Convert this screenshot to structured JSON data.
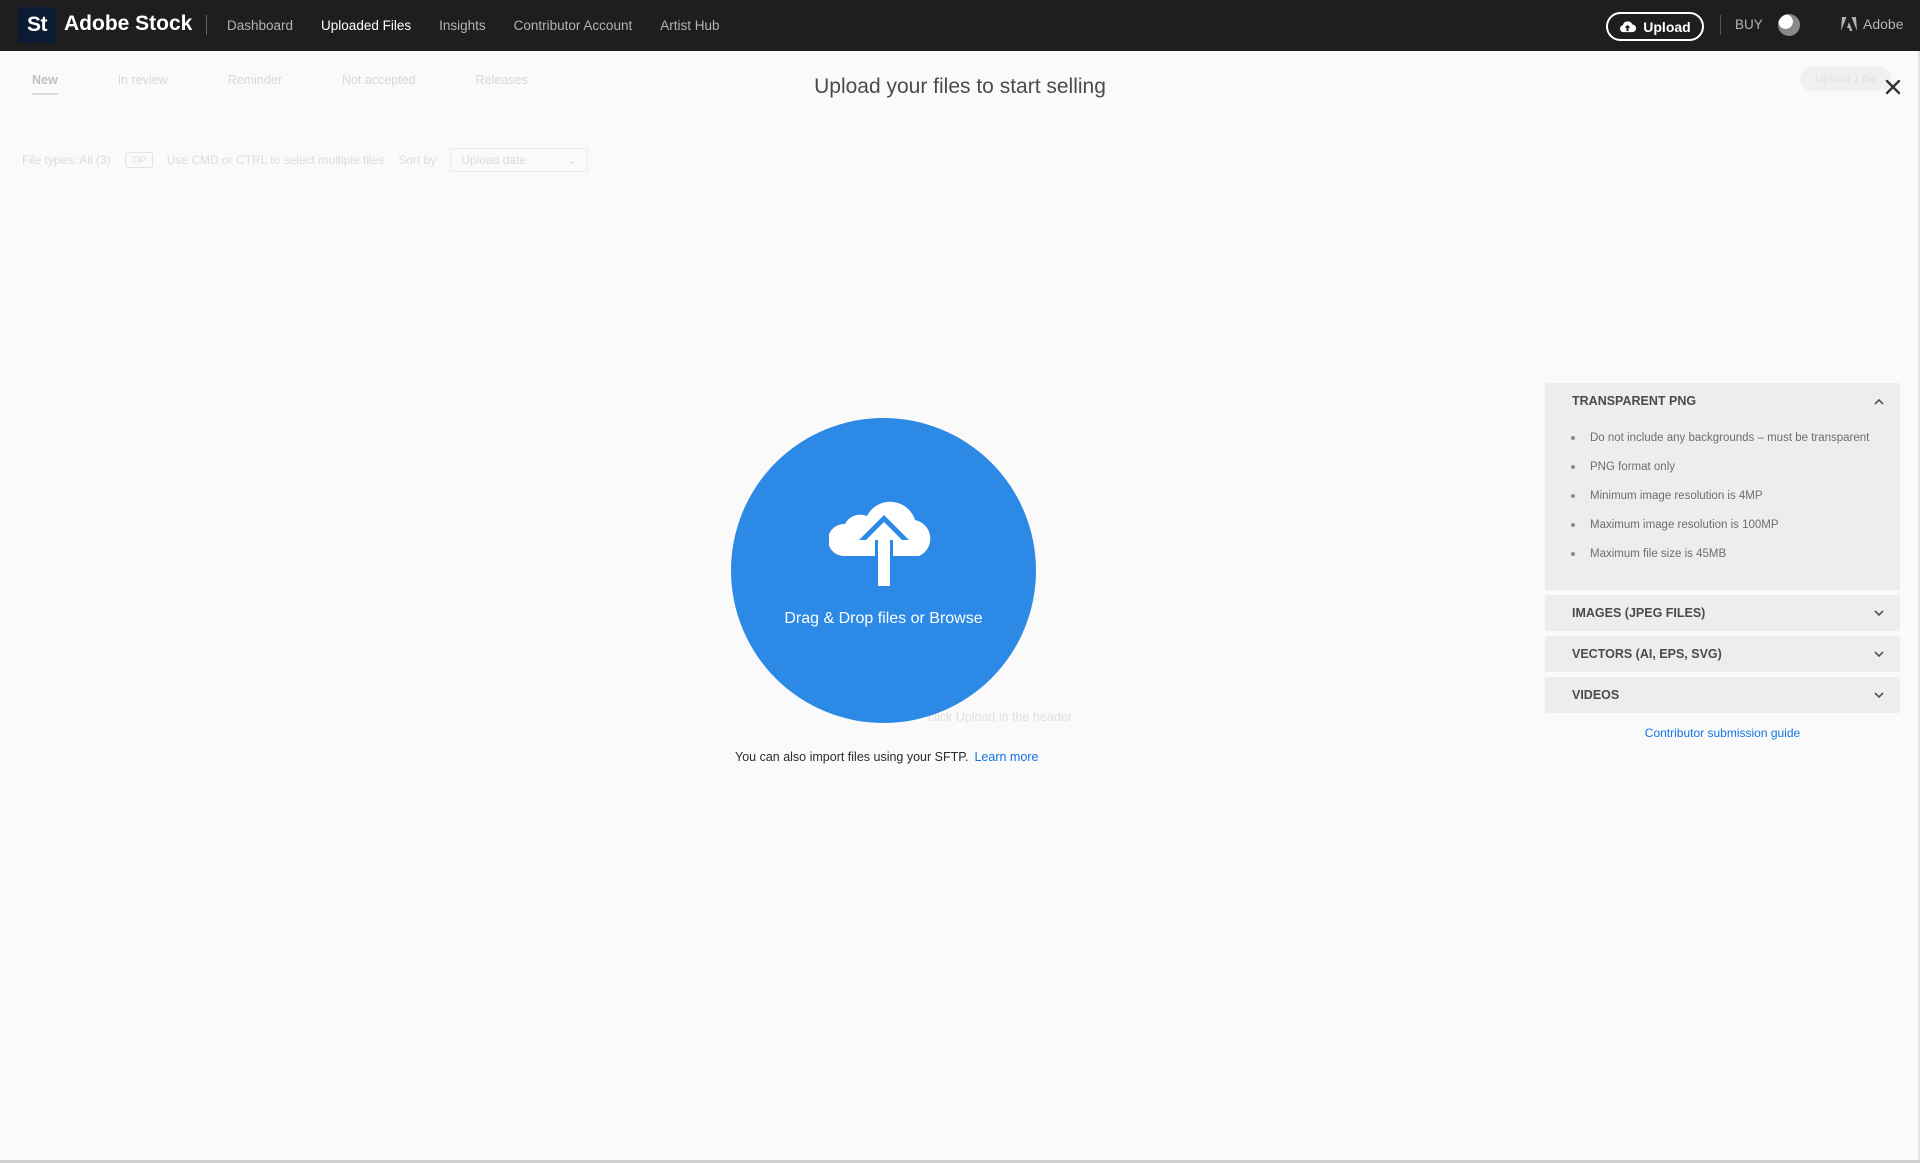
{
  "topbar": {
    "logo_text": "St",
    "brand": "Adobe Stock",
    "nav": [
      "Dashboard",
      "Uploaded Files",
      "Insights",
      "Contributor Account",
      "Artist Hub"
    ],
    "active_nav": "Uploaded Files",
    "upload_label": "Upload",
    "buy_label": "BUY",
    "adobe_label": "Adobe"
  },
  "background": {
    "tabs": [
      "New",
      "In review",
      "Reminder",
      "Not accepted",
      "Releases"
    ],
    "file_types": "File types: All (3)",
    "tip": "TIP",
    "tip_text": "Use CMD or CTRL to select multiple files",
    "sort_label": "Sort by",
    "sort_value": "Upload date",
    "hint": "click Upload in the header",
    "pill": "Upload 1 file"
  },
  "modal": {
    "title": "Upload your files to start selling",
    "drop_text": "Drag & Drop files or Browse",
    "sftp_text": "You can also import files using your SFTP.",
    "learn_more": "Learn more"
  },
  "panel": {
    "sections": [
      {
        "title": "TRANSPARENT PNG",
        "expanded": true,
        "items": [
          "Do not include any backgrounds – must be transparent",
          "PNG format only",
          "Minimum image resolution is 4MP",
          "Maximum image resolution is 100MP",
          "Maximum file size is 45MB"
        ]
      },
      {
        "title": "IMAGES (JPEG FILES)",
        "expanded": false
      },
      {
        "title": "VECTORS (AI, EPS, SVG)",
        "expanded": false
      },
      {
        "title": "VIDEOS",
        "expanded": false
      }
    ],
    "guide_link": "Contributor submission guide"
  },
  "colors": {
    "topbar": "#1e1e1e",
    "accent_blue": "#2c8ae6",
    "link_blue": "#1473e6",
    "panel_bg": "#ededed"
  },
  "icons": [
    "cloud-upload-icon",
    "close-icon",
    "chevron-up-icon",
    "chevron-down-icon",
    "adobe-logo-icon",
    "globe-avatar"
  ]
}
